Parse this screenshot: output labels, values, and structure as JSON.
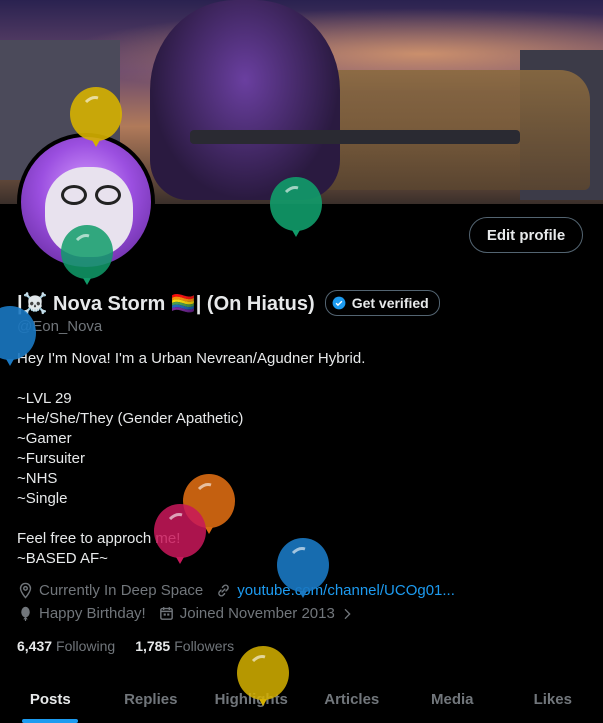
{
  "profile": {
    "edit_profile_label": "Edit profile",
    "display_name": "|☠️ Nova Storm 🏳️‍🌈| (On Hiatus)",
    "get_verified_label": "Get verified",
    "handle": "@Eon_Nova"
  },
  "bio": {
    "lines": [
      "Hey I'm Nova! I'm a Urban Nevrean/Agudner Hybrid.",
      "",
      "~LVL 29",
      "~He/She/They (Gender Apathetic)",
      "~Gamer",
      "~Fursuiter",
      "~NHS",
      "~Single",
      "",
      "Feel free to approch me!",
      "~BASED AF~"
    ]
  },
  "meta": {
    "location": "Currently In Deep Space",
    "website": "youtube.com/channel/UCOg01...",
    "birthday": "Happy Birthday!",
    "joined": "Joined November 2013"
  },
  "stats": {
    "following_count": "6,437",
    "following_label": "Following",
    "followers_count": "1,785",
    "followers_label": "Followers"
  },
  "tabs": [
    "Posts",
    "Replies",
    "Highlights",
    "Articles",
    "Media",
    "Likes"
  ],
  "colors": {
    "accent": "#1d9bf0",
    "muted": "#71767b",
    "text": "#e7e9ea",
    "balloon_yellow": "#d6b100",
    "balloon_green": "#119c6a",
    "balloon_orange": "#d96a12",
    "balloon_pink": "#c9185b",
    "balloon_blue": "#1a78c2"
  },
  "icons": [
    "location-icon",
    "link-icon",
    "balloon-icon",
    "calendar-icon",
    "verified-badge-icon",
    "chevron-right-icon"
  ]
}
